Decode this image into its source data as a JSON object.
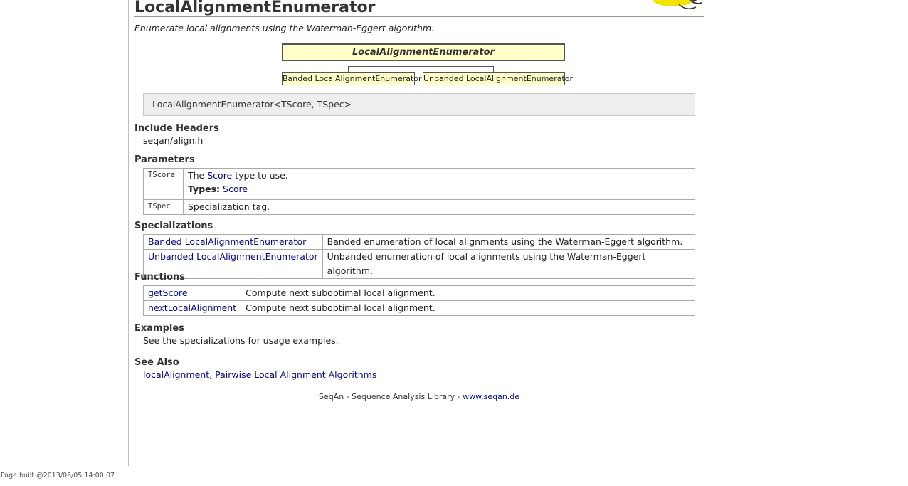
{
  "page": {
    "title": "LocalAlignmentEnumerator",
    "summary": "Enumerate local alignments using the Waterman-Eggert algorithm.",
    "built": "Page built @2013/06/05 14:00:07"
  },
  "diagram": {
    "root": "LocalAlignmentEnumerator",
    "children": [
      "Banded LocalAlignmentEnumerator",
      "Unbanded LocalAlignmentEnumerator"
    ]
  },
  "signature": "LocalAlignmentEnumerator<TScore, TSpec>",
  "include_headers": {
    "heading": "Include Headers",
    "value": "seqan/align.h"
  },
  "parameters": {
    "heading": "Parameters",
    "rows": [
      {
        "name": "TScore",
        "desc_prefix": "The ",
        "desc_link": "Score",
        "desc_suffix": " type to use.",
        "types_label": "Types:",
        "types_value": "Score"
      },
      {
        "name": "TSpec",
        "desc": "Specialization tag."
      }
    ]
  },
  "specializations": {
    "heading": "Specializations",
    "rows": [
      {
        "name": "Banded LocalAlignmentEnumerator",
        "desc": "Banded enumeration of local alignments using the Waterman-Eggert algorithm."
      },
      {
        "name": "Unbanded LocalAlignmentEnumerator",
        "desc": "Unbanded enumeration of local alignments using the Waterman-Eggert algorithm."
      }
    ]
  },
  "functions": {
    "heading": "Functions",
    "rows": [
      {
        "name": "getScore",
        "desc": "Compute next suboptimal local alignment."
      },
      {
        "name": "nextLocalAlignment",
        "desc": "Compute next suboptimal local alignment."
      }
    ]
  },
  "examples": {
    "heading": "Examples",
    "text": "See the specializations for usage examples."
  },
  "see_also": {
    "heading": "See Also",
    "links": [
      "localAlignment",
      "Pairwise Local Alignment Algorithms"
    ],
    "separator": ", "
  },
  "footer": {
    "text": "SeqAn - Sequence Analysis Library - ",
    "link": "www.seqan.de"
  },
  "colors": {
    "link": "#00088a",
    "diagram_fill": "#ffffc8",
    "signature_bg": "#eeeeee",
    "logo_yellow": "#f2e400"
  },
  "logo": {
    "icon": "seqan-logo-icon"
  }
}
